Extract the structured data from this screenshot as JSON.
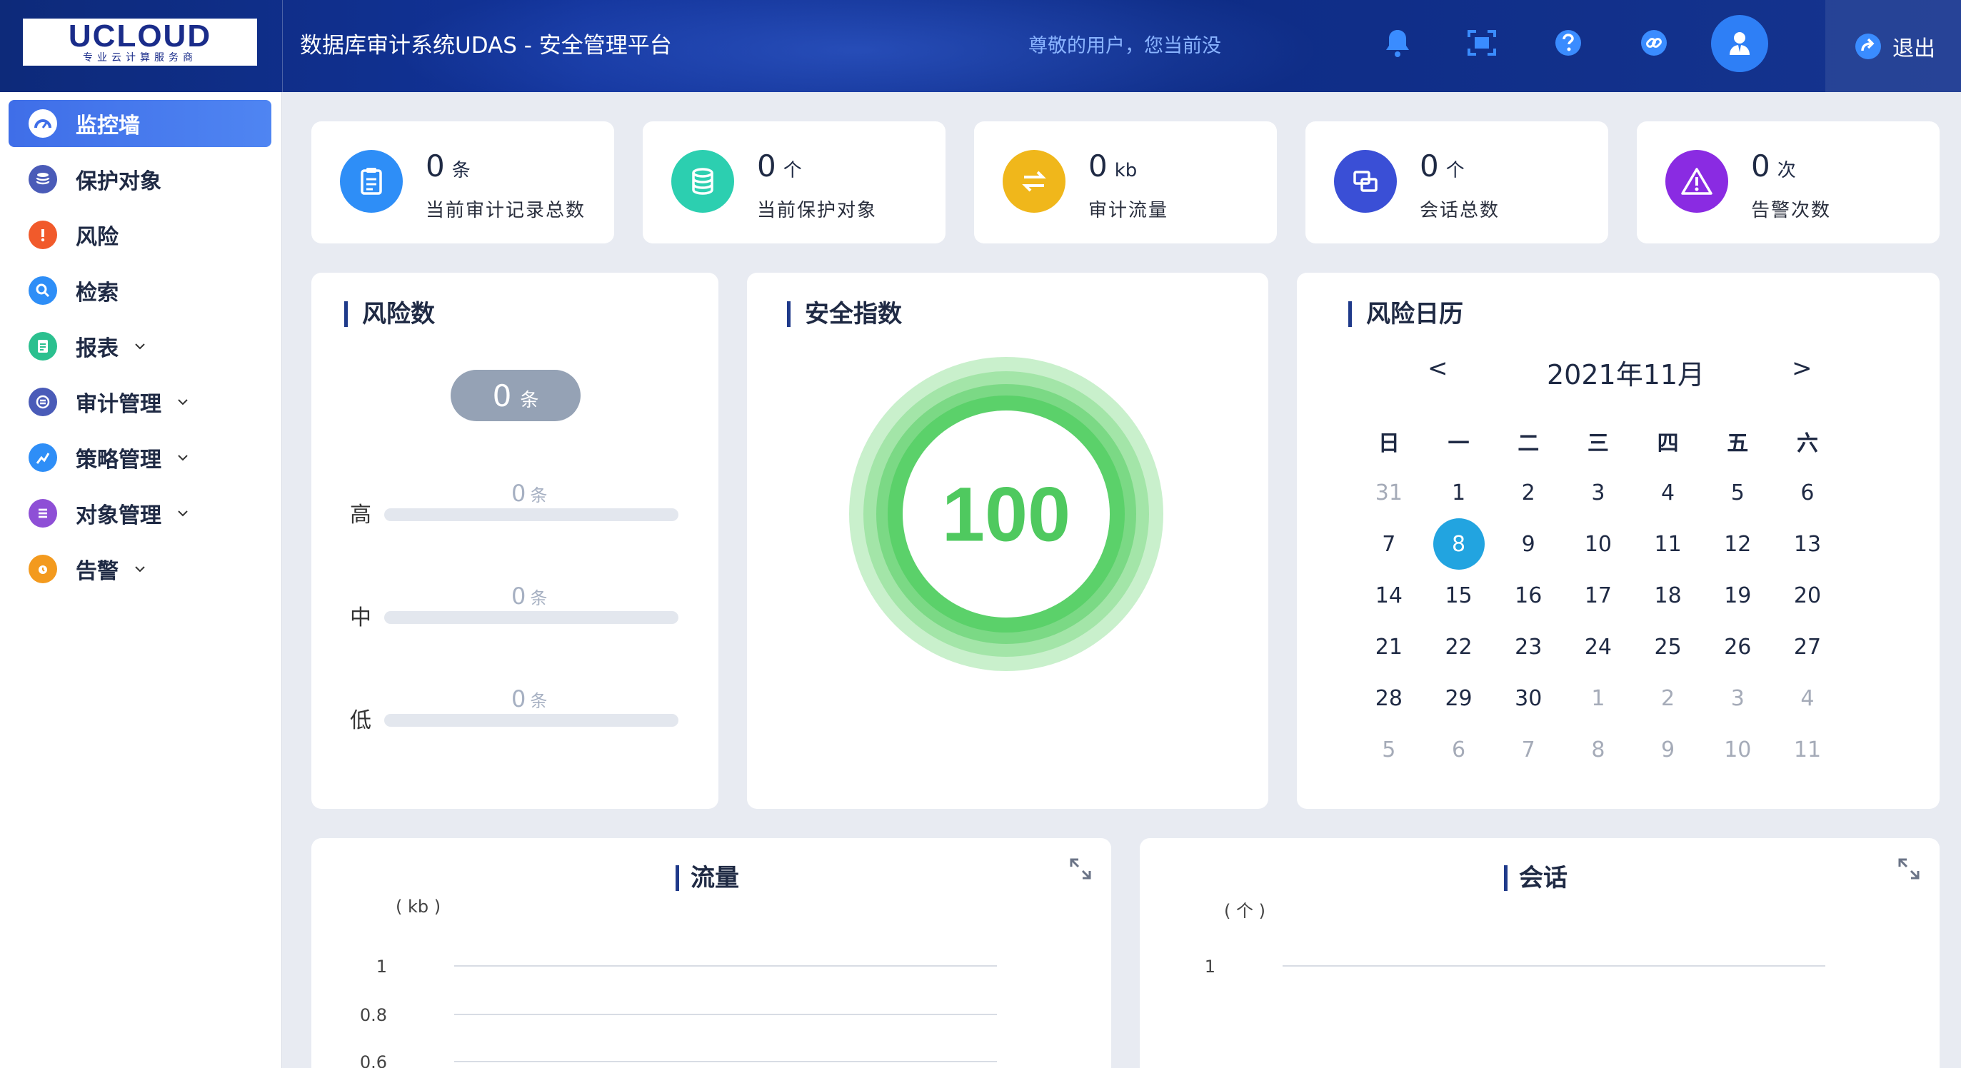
{
  "header": {
    "logo_main": "UCLOUD",
    "logo_sub": "专业云计算服务商",
    "title": "数据库审计系统UDAS - 安全管理平台",
    "greeting": "尊敬的用户，您当前没",
    "logout_label": "退出",
    "icons": [
      "bell-icon",
      "fullscreen-icon",
      "help-icon",
      "link-icon",
      "user-icon",
      "logout-icon"
    ]
  },
  "sidebar": {
    "items": [
      {
        "label": "监控墙",
        "icon": "dashboard-icon",
        "color": "#ffffff",
        "active": true
      },
      {
        "label": "保护对象",
        "icon": "database-icon",
        "color": "#4a5bb8"
      },
      {
        "label": "风险",
        "icon": "alert-icon",
        "color": "#f15a2b"
      },
      {
        "label": "检索",
        "icon": "search-icon",
        "color": "#2e8ef7"
      },
      {
        "label": "报表",
        "icon": "report-icon",
        "color": "#2bc08f",
        "expandable": true
      },
      {
        "label": "审计管理",
        "icon": "audit-icon",
        "color": "#4a5bb8",
        "expandable": true
      },
      {
        "label": "策略管理",
        "icon": "policy-icon",
        "color": "#2e8ef7",
        "expandable": true
      },
      {
        "label": "对象管理",
        "icon": "object-icon",
        "color": "#8e4fd6",
        "expandable": true
      },
      {
        "label": "告警",
        "icon": "alarm-icon",
        "color": "#f39a1e",
        "expandable": true
      }
    ]
  },
  "stats": [
    {
      "value": "0",
      "unit": "条",
      "label": "当前审计记录总数",
      "color": "#2e8ef7",
      "icon": "clipboard-icon"
    },
    {
      "value": "0",
      "unit": "个",
      "label": "当前保护对象",
      "color": "#2ccfb0",
      "icon": "database-icon"
    },
    {
      "value": "0",
      "unit": "kb",
      "label": "审计流量",
      "color": "#f0b71b",
      "icon": "transfer-icon"
    },
    {
      "value": "0",
      "unit": "个",
      "label": "会话总数",
      "color": "#3a4fd6",
      "icon": "session-icon"
    },
    {
      "value": "0",
      "unit": "次",
      "label": "告警次数",
      "color": "#8a2be2",
      "icon": "warning-icon"
    }
  ],
  "risk": {
    "title": "风险数",
    "total": "0",
    "total_unit": "条",
    "levels": [
      {
        "label": "高",
        "value": "0",
        "unit": "条",
        "fraction": 0
      },
      {
        "label": "中",
        "value": "0",
        "unit": "条",
        "fraction": 0
      },
      {
        "label": "低",
        "value": "0",
        "unit": "条",
        "fraction": 0
      }
    ]
  },
  "security": {
    "title": "安全指数",
    "score": "100",
    "color": "#5bd16a"
  },
  "calendar": {
    "title": "风险日历",
    "prev": "<",
    "next": ">",
    "month": "2021年11月",
    "weekdays": [
      "日",
      "一",
      "二",
      "三",
      "四",
      "五",
      "六"
    ],
    "weeks": [
      [
        {
          "d": "31",
          "m": true
        },
        {
          "d": "1"
        },
        {
          "d": "2"
        },
        {
          "d": "3"
        },
        {
          "d": "4"
        },
        {
          "d": "5"
        },
        {
          "d": "6"
        }
      ],
      [
        {
          "d": "7"
        },
        {
          "d": "8",
          "today": true
        },
        {
          "d": "9"
        },
        {
          "d": "10"
        },
        {
          "d": "11"
        },
        {
          "d": "12"
        },
        {
          "d": "13"
        }
      ],
      [
        {
          "d": "14"
        },
        {
          "d": "15"
        },
        {
          "d": "16"
        },
        {
          "d": "17"
        },
        {
          "d": "18"
        },
        {
          "d": "19"
        },
        {
          "d": "20"
        }
      ],
      [
        {
          "d": "21"
        },
        {
          "d": "22"
        },
        {
          "d": "23"
        },
        {
          "d": "24"
        },
        {
          "d": "25"
        },
        {
          "d": "26"
        },
        {
          "d": "27"
        }
      ],
      [
        {
          "d": "28"
        },
        {
          "d": "29"
        },
        {
          "d": "30"
        },
        {
          "d": "1",
          "m": true
        },
        {
          "d": "2",
          "m": true
        },
        {
          "d": "3",
          "m": true
        },
        {
          "d": "4",
          "m": true
        }
      ],
      [
        {
          "d": "5",
          "m": true
        },
        {
          "d": "6",
          "m": true
        },
        {
          "d": "7",
          "m": true
        },
        {
          "d": "8",
          "m": true
        },
        {
          "d": "9",
          "m": true
        },
        {
          "d": "10",
          "m": true
        },
        {
          "d": "11",
          "m": true
        }
      ]
    ]
  },
  "traffic_chart": {
    "title": "流量",
    "unit": "( kb )",
    "ticks": [
      "1",
      "0.8",
      "0.6"
    ]
  },
  "session_chart": {
    "title": "会话",
    "unit": "( 个 )",
    "ticks": [
      "1"
    ]
  }
}
